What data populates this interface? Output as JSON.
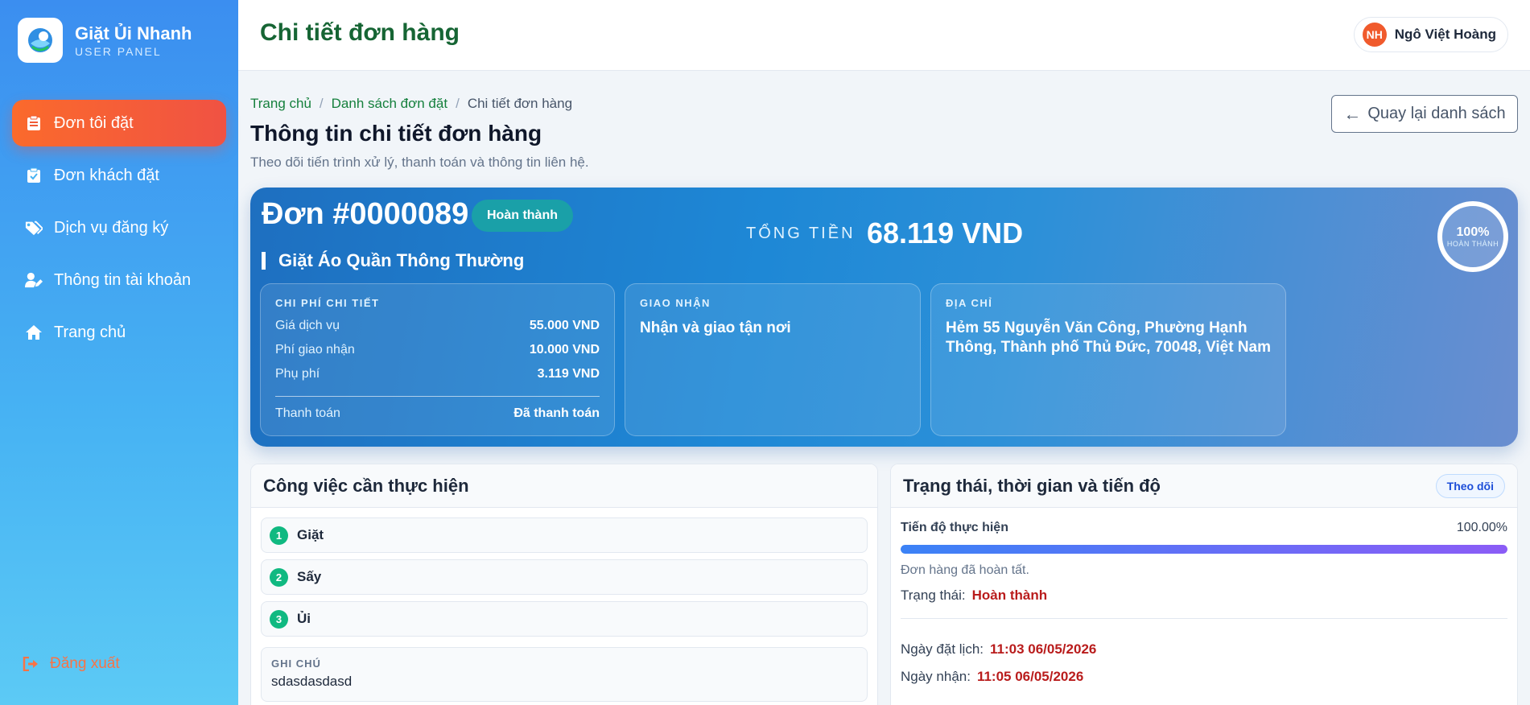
{
  "brand": {
    "title": "Giặt Ủi Nhanh",
    "subtitle": "USER PANEL"
  },
  "sidebar": {
    "items": [
      {
        "label": "Đơn tôi đặt",
        "icon": "clipboard-list-icon",
        "active": true
      },
      {
        "label": "Đơn khách đặt",
        "icon": "clipboard-check-icon",
        "active": false
      },
      {
        "label": "Dịch vụ đăng ký",
        "icon": "tags-icon",
        "active": false
      },
      {
        "label": "Thông tin tài khoản",
        "icon": "user-edit-icon",
        "active": false
      },
      {
        "label": "Trang chủ",
        "icon": "home-icon",
        "active": false
      }
    ],
    "logout": "Đăng xuất"
  },
  "topbar": {
    "title": "Chi tiết đơn hàng",
    "user_initials": "NH",
    "user_name": "Ngô Việt Hoàng"
  },
  "breadcrumb": {
    "home": "Trang chủ",
    "list": "Danh sách đơn đặt",
    "current": "Chi tiết đơn hàng"
  },
  "back_button": "Quay lại danh sách",
  "page": {
    "heading": "Thông tin chi tiết đơn hàng",
    "subtitle": "Theo dõi tiến trình xử lý, thanh toán và thông tin liên hệ."
  },
  "order": {
    "number": "Đơn #0000089",
    "status": "Hoàn thành",
    "total_label": "TỔNG TIỀN",
    "total_value": "68.119 VND",
    "progress_value": "100%",
    "progress_label": "HOÀN THÀNH",
    "service_name": "Giặt Áo Quần Thông Thường",
    "cost": {
      "heading": "CHI PHÍ CHI TIẾT",
      "rows": [
        {
          "label": "Giá dịch vụ",
          "value": "55.000 VND"
        },
        {
          "label": "Phí giao nhận",
          "value": "10.000 VND"
        },
        {
          "label": "Phụ phí",
          "value": "3.119 VND"
        }
      ],
      "payment_label": "Thanh toán",
      "payment_value": "Đã thanh toán"
    },
    "delivery": {
      "heading": "GIAO NHẬN",
      "value": "Nhận và giao tận nơi"
    },
    "address": {
      "heading": "ĐỊA CHỈ",
      "value": "Hẻm 55 Nguyễn Văn Công, Phường Hạnh Thông, Thành phố Thủ Đức, 70048, Việt Nam"
    }
  },
  "tasks_card": {
    "title": "Công việc cần thực hiện",
    "tasks": [
      {
        "num": "1",
        "label": "Giặt"
      },
      {
        "num": "2",
        "label": "Sấy"
      },
      {
        "num": "3",
        "label": "Ủi"
      }
    ],
    "note_label": "GHI CHÚ",
    "note_text": "sdasdasdasd"
  },
  "status_card": {
    "title": "Trạng thái, thời gian và tiến độ",
    "badge": "Theo dõi",
    "progress_label": "Tiến độ thực hiện",
    "progress_percent": "100.00%",
    "progress_fraction": 1.0,
    "progress_note": "Đơn hàng đã hoàn tất.",
    "status_label": "Trạng thái:",
    "status_value": "Hoàn thành",
    "booked_label": "Ngày đặt lịch:",
    "booked_value": "11:03 06/05/2026",
    "received_label": "Ngày nhận:",
    "received_value": "11:05 06/05/2026"
  },
  "colors": {
    "accent_green": "#166534",
    "active_nav": "#f05243",
    "danger_text": "#b91c1c"
  }
}
